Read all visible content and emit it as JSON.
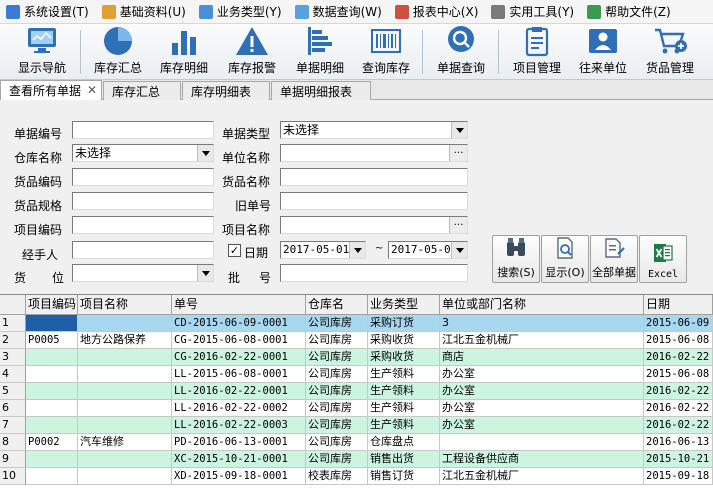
{
  "menu": [
    {
      "label": "系统设置(T)",
      "icon": "settings-icon",
      "color": "#3a7bd5"
    },
    {
      "label": "基础资料(U)",
      "icon": "folder-icon",
      "color": "#e0a030"
    },
    {
      "label": "业务类型(Y)",
      "icon": "doc-icon",
      "color": "#4a90d9"
    },
    {
      "label": "数据查询(W)",
      "icon": "query-icon",
      "color": "#5aa0e0"
    },
    {
      "label": "报表中心(X)",
      "icon": "report-icon",
      "color": "#d05040"
    },
    {
      "label": "实用工具(Y)",
      "icon": "tools-icon",
      "color": "#7a7a7a"
    },
    {
      "label": "帮助文件(Z)",
      "icon": "help-icon",
      "color": "#3a9a50"
    }
  ],
  "toolbar": {
    "nav": "显示导航",
    "inv_summary": "库存汇总",
    "inv_detail": "库存明细",
    "inv_alarm": "库存报警",
    "doc_detail": "单据明细",
    "inv_query": "查询库存",
    "doc_query": "单据查询",
    "project_mgmt": "项目管理",
    "partner": "往来单位",
    "goods_mgmt": "货品管理"
  },
  "tabs": {
    "t0": "查看所有单据",
    "t1": "库存汇总",
    "t2": "库存明细表",
    "t3": "单据明细报表",
    "close": "✕"
  },
  "form": {
    "doc_no_label": "单据编号",
    "doc_no": "",
    "doc_type_label": "单据类型",
    "doc_type": "未选择",
    "warehouse_label": "仓库名称",
    "warehouse": "未选择",
    "unit_label": "单位名称",
    "unit": "",
    "goods_code_label": "货品编码",
    "goods_code": "",
    "goods_name_label": "货品名称",
    "goods_name": "",
    "spec_label": "货品规格",
    "spec": "",
    "old_no_label": "旧单号",
    "old_no": "",
    "proj_code_label": "项目编码",
    "proj_code": "",
    "proj_name_label": "项目名称",
    "proj_name": "",
    "handler_label": "经手人",
    "handler": "",
    "date_label": "日期",
    "date_checked": "✓",
    "date_from": "2017-05-01",
    "date_sep": "~",
    "date_to": "2017-05-05",
    "position_label1": "货",
    "position_label2": "位",
    "position": "",
    "batch_label1": "批",
    "batch_label2": "号",
    "batch": "",
    "ellipsis": "…",
    "btn_search": "搜索(S)",
    "btn_show": "显示(O)",
    "btn_all": "全部单据",
    "btn_excel": "Excel"
  },
  "grid": {
    "columns": [
      "项目编码",
      "项目名称",
      "单号",
      "仓库名",
      "业务类型",
      "单位或部门名称",
      "日期"
    ],
    "rows": [
      {
        "n": "1",
        "code": "",
        "name": "",
        "no": "CD-2015-06-09-0001",
        "wh": "公司库房",
        "type": "采购订货",
        "unit": "3",
        "date": "2015-06-09"
      },
      {
        "n": "2",
        "code": "P0005",
        "name": "地方公路保养",
        "no": "CG-2015-06-08-0001",
        "wh": "公司库房",
        "type": "采购收货",
        "unit": "江北五金机械厂",
        "date": "2015-06-08"
      },
      {
        "n": "3",
        "code": "",
        "name": "",
        "no": "CG-2016-02-22-0001",
        "wh": "公司库房",
        "type": "采购收货",
        "unit": "商店",
        "date": "2016-02-22"
      },
      {
        "n": "4",
        "code": "",
        "name": "",
        "no": "LL-2015-06-08-0001",
        "wh": "公司库房",
        "type": "生产领料",
        "unit": "办公室",
        "date": "2015-06-08"
      },
      {
        "n": "5",
        "code": "",
        "name": "",
        "no": "LL-2016-02-22-0001",
        "wh": "公司库房",
        "type": "生产领料",
        "unit": "办公室",
        "date": "2016-02-22"
      },
      {
        "n": "6",
        "code": "",
        "name": "",
        "no": "LL-2016-02-22-0002",
        "wh": "公司库房",
        "type": "生产领料",
        "unit": "办公室",
        "date": "2016-02-22"
      },
      {
        "n": "7",
        "code": "",
        "name": "",
        "no": "LL-2016-02-22-0003",
        "wh": "公司库房",
        "type": "生产领料",
        "unit": "办公室",
        "date": "2016-02-22"
      },
      {
        "n": "8",
        "code": "P0002",
        "name": "汽车维修",
        "no": "PD-2016-06-13-0001",
        "wh": "公司库房",
        "type": "仓库盘点",
        "unit": "",
        "date": "2016-06-13"
      },
      {
        "n": "9",
        "code": "",
        "name": "",
        "no": "XC-2015-10-21-0001",
        "wh": "公司库房",
        "type": "销售出货",
        "unit": "工程设备供应商",
        "date": "2015-10-21"
      },
      {
        "n": "10",
        "code": "",
        "name": "",
        "no": "XD-2015-09-18-0001",
        "wh": "校表库房",
        "type": "销售订货",
        "unit": "江北五金机械厂",
        "date": "2015-09-18"
      }
    ]
  },
  "colors": {
    "accent": "#2f6fb5",
    "row_alt": "#ccf5e0",
    "row_selected": "#a8d8f0"
  }
}
